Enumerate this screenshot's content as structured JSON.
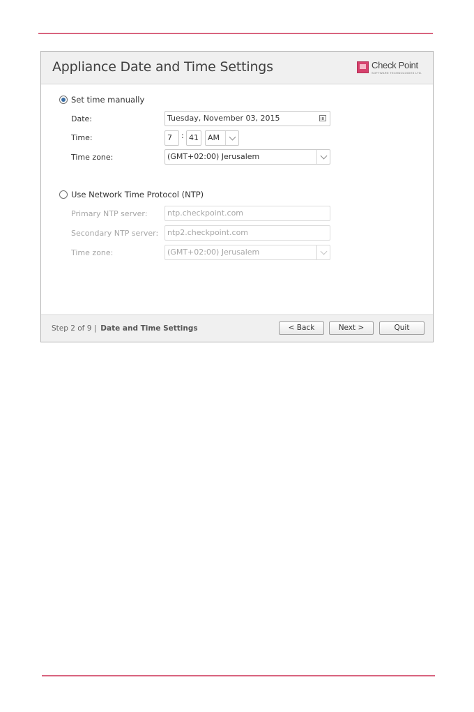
{
  "window": {
    "title": "Appliance Date and Time Settings",
    "logo": {
      "name": "Check Point",
      "tagline": "SOFTWARE TECHNOLOGIES LTD."
    }
  },
  "manual": {
    "radio_label": "Set time manually",
    "selected": true,
    "date_label": "Date:",
    "date_value": "Tuesday, November 03, 2015",
    "time_label": "Time:",
    "hour": "7",
    "separator": ":",
    "minute": "41",
    "ampm": "AM",
    "timezone_label": "Time zone:",
    "timezone_value": "(GMT+02:00) Jerusalem"
  },
  "ntp": {
    "radio_label": "Use Network Time Protocol (NTP)",
    "selected": false,
    "primary_label": "Primary NTP server:",
    "primary_value": "ntp.checkpoint.com",
    "secondary_label": "Secondary NTP server:",
    "secondary_value": "ntp2.checkpoint.com",
    "timezone_label": "Time zone:",
    "timezone_value": "(GMT+02:00) Jerusalem"
  },
  "footer": {
    "step_text": "Step 2 of 9 |",
    "step_title": "Date and Time Settings",
    "back_label": "< Back",
    "next_label": "Next >",
    "quit_label": "Quit"
  },
  "colors": {
    "accent_rule": "#d9647f",
    "radio_selected": "#3a6ea5",
    "logo": "#d6416d"
  }
}
